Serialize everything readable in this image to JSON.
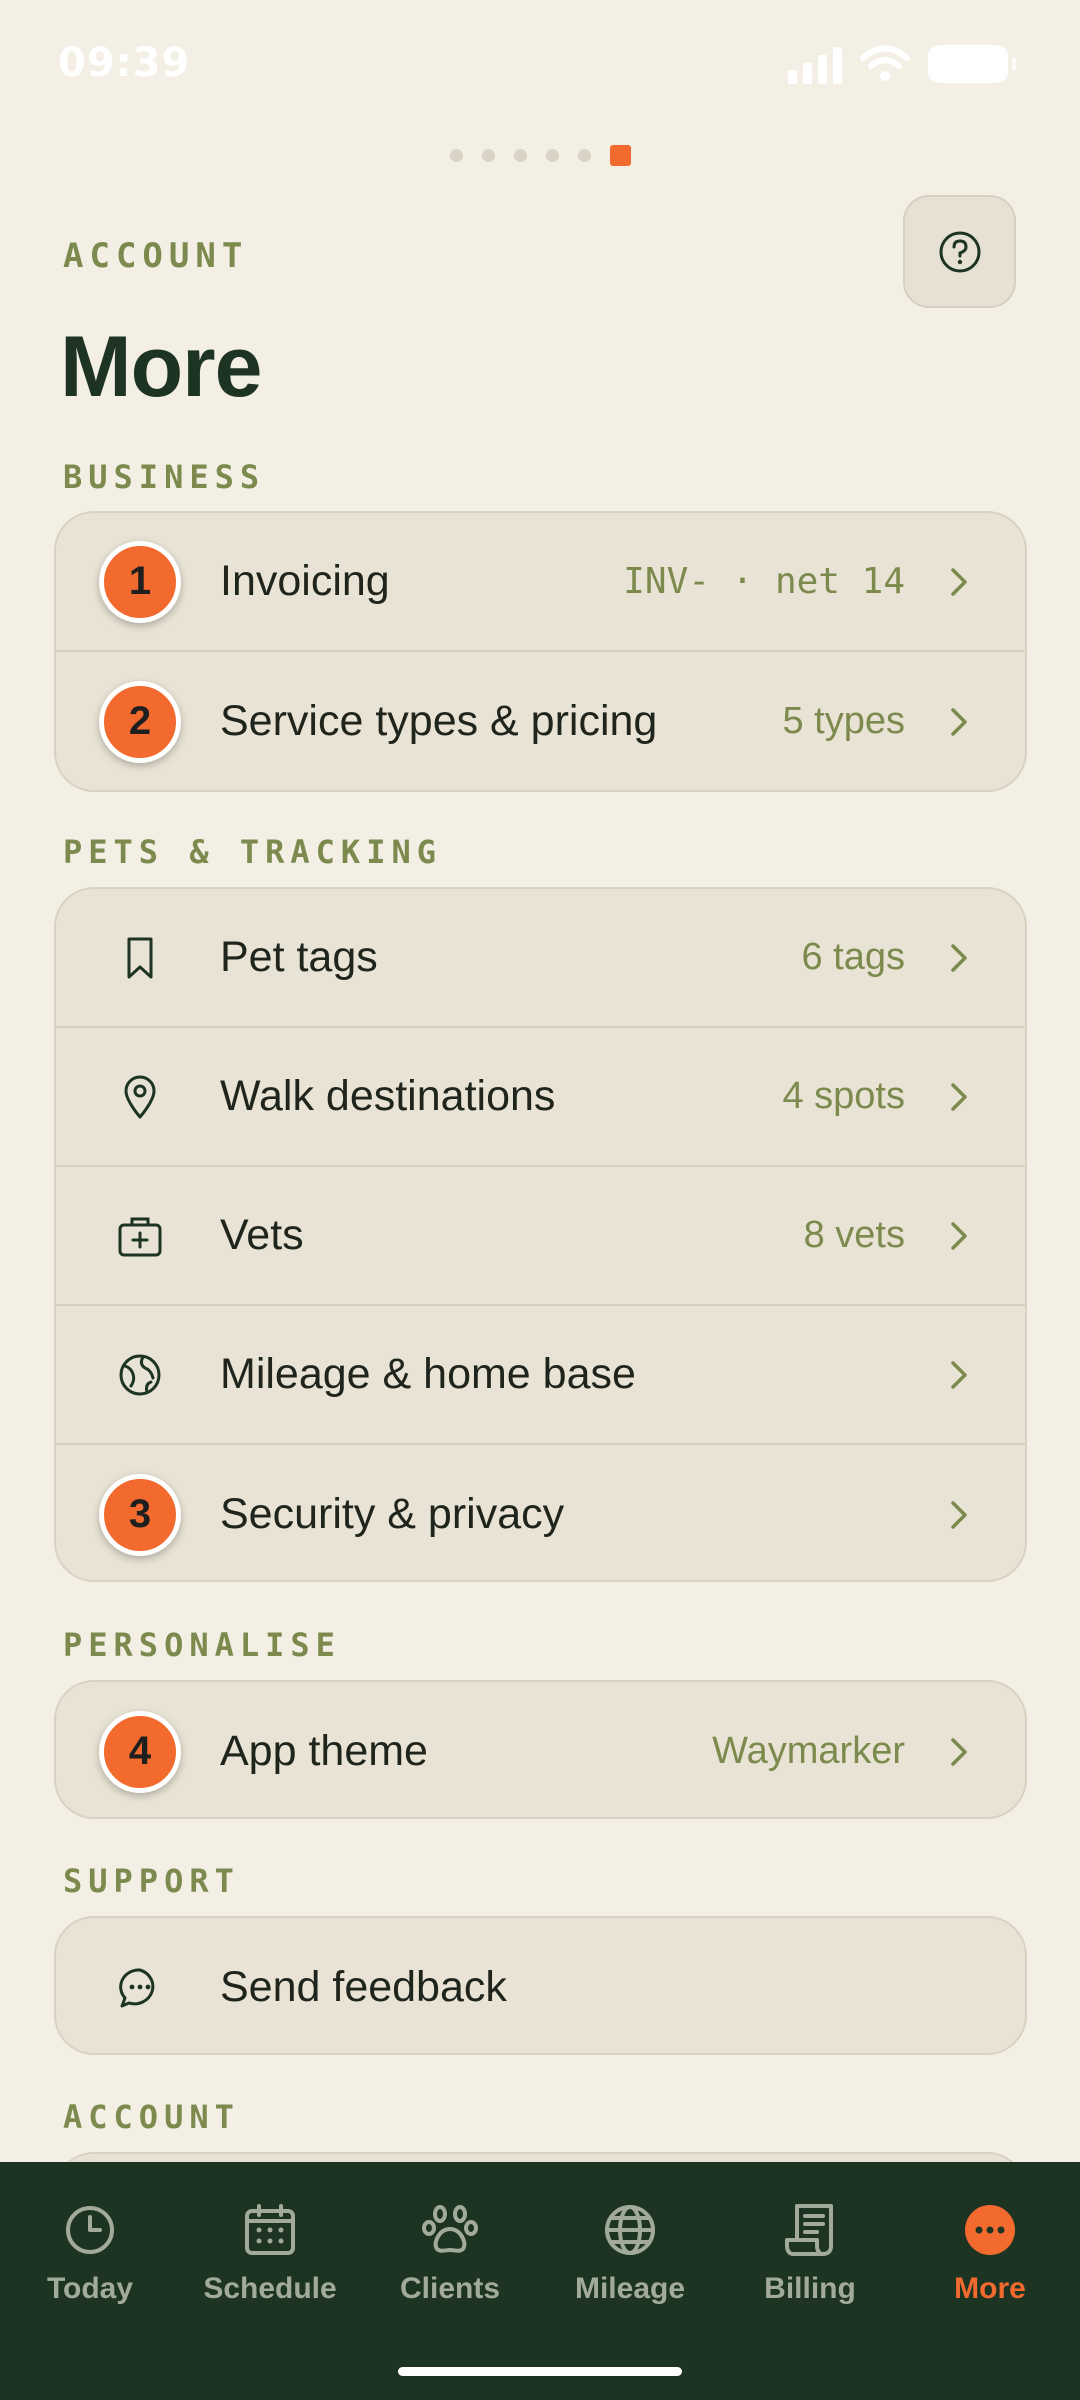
{
  "status": {
    "time": "09:39"
  },
  "header": {
    "eyebrow": "ACCOUNT",
    "title": "More",
    "help_icon": "help-circle-icon"
  },
  "pagination": {
    "count": 6,
    "active_index": 5
  },
  "sections": {
    "business": {
      "label": "BUSINESS",
      "items": [
        {
          "badge": "1",
          "label": "Invoicing",
          "value": "INV- · net 14"
        },
        {
          "badge": "2",
          "label": "Service types & pricing",
          "value": "5 types"
        }
      ]
    },
    "pets": {
      "label": "PETS & TRACKING",
      "items": [
        {
          "icon": "bookmark-icon",
          "label": "Pet tags",
          "value": "6 tags"
        },
        {
          "icon": "map-pin-icon",
          "label": "Walk destinations",
          "value": "4 spots"
        },
        {
          "icon": "medical-bag-icon",
          "label": "Vets",
          "value": "8 vets"
        },
        {
          "icon": "globe-icon",
          "label": "Mileage & home base",
          "value": ""
        },
        {
          "badge": "3",
          "label": "Security & privacy",
          "value": ""
        }
      ]
    },
    "personalise": {
      "label": "PERSONALISE",
      "items": [
        {
          "badge": "4",
          "label": "App theme",
          "value": "Waymarker"
        }
      ]
    },
    "support": {
      "label": "SUPPORT",
      "items": [
        {
          "icon": "chat-bubble-icon",
          "label": "Send feedback"
        }
      ]
    },
    "account": {
      "label": "ACCOUNT"
    }
  },
  "tabs": [
    {
      "label": "Today",
      "icon": "clock-icon"
    },
    {
      "label": "Schedule",
      "icon": "calendar-icon"
    },
    {
      "label": "Clients",
      "icon": "paw-icon"
    },
    {
      "label": "Mileage",
      "icon": "globe-icon"
    },
    {
      "label": "Billing",
      "icon": "receipt-icon"
    },
    {
      "label": "More",
      "icon": "more-dots-icon",
      "active": true
    }
  ],
  "colors": {
    "background": "#f3efe5",
    "card": "#e8e3d4",
    "accent": "#f26a2e",
    "olive": "#7c8a4e",
    "dark_green": "#1e3423"
  }
}
